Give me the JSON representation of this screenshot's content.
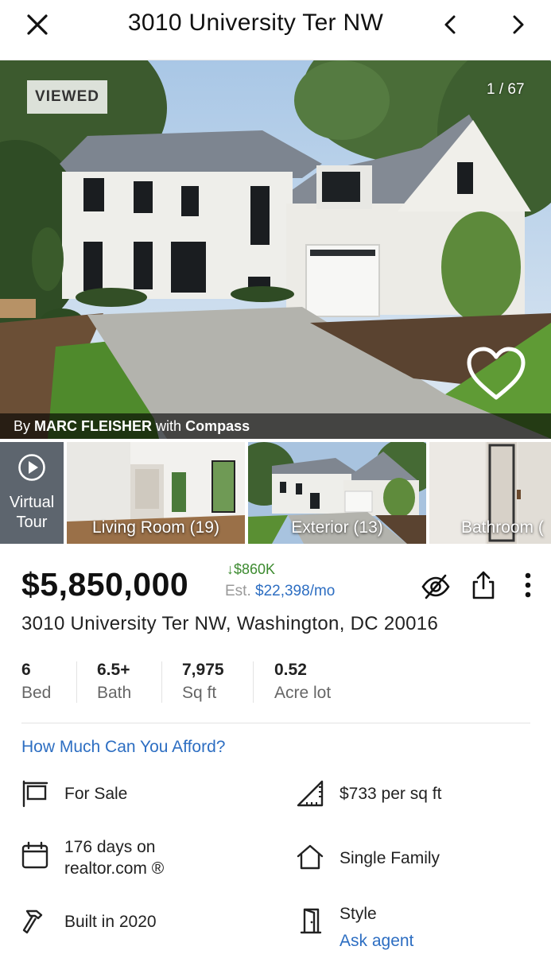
{
  "header": {
    "title": "3010 University Ter NW",
    "close_icon": "close-icon",
    "prev_icon": "chevron-left-icon",
    "next_icon": "chevron-right-icon"
  },
  "hero": {
    "badge": "VIEWED",
    "counter": "1 / 67",
    "credit_prefix": "By",
    "agent": "MARC FLEISHER",
    "credit_with": "with",
    "brokerage": "Compass",
    "heart_icon": "heart-outline-icon"
  },
  "thumbnails": [
    {
      "label": "Virtual\nTour",
      "icon": "play-circle-icon"
    },
    {
      "label": "Living Room (19)"
    },
    {
      "label": "Exterior (13)"
    },
    {
      "label": "Bathroom ("
    }
  ],
  "listing": {
    "price": "$5,850,000",
    "price_change": "$860K",
    "est_prefix": "Est.",
    "est_monthly": "$22,398/mo",
    "address": "3010 University Ter NW, Washington, DC 20016",
    "actions": [
      "hide-icon",
      "share-icon",
      "more-vertical-icon"
    ]
  },
  "stats": [
    {
      "value": "6",
      "label": "Bed"
    },
    {
      "value": "6.5+",
      "label": "Bath"
    },
    {
      "value": "7,975",
      "label": "Sq ft"
    },
    {
      "value": "0.52",
      "label": "Acre lot"
    }
  ],
  "afford_link": "How Much Can You Afford?",
  "facts": {
    "status": "For Sale",
    "price_per_sqft": "$733 per sq ft",
    "days_line1": "176 days on",
    "days_line2": "realtor.com ®",
    "property_type": "Single Family",
    "built": "Built in 2020",
    "style_label": "Style",
    "style_link": "Ask agent"
  },
  "colors": {
    "link_blue": "#2d6ec2",
    "price_cut_green": "#3c8a2f",
    "tour_tile": "#5d656e"
  }
}
